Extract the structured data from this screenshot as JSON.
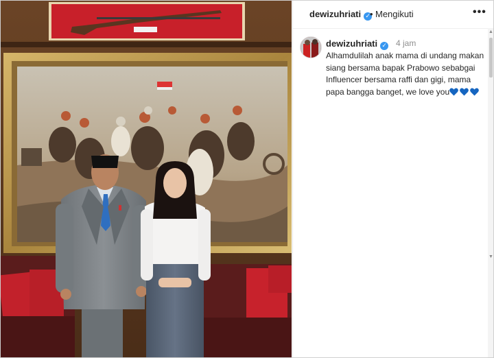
{
  "post": {
    "username": "dewizuhriati",
    "separator": "•",
    "follow_status": "Mengikuti",
    "more_icon": "more-options-icon"
  },
  "caption": {
    "username": "dewizuhriati",
    "time": "4 jam",
    "text": "Alhamdulilah anak mama di undang makan siang bersama bapak Prabowo sebabgai Influencer bersama raffi dan gigi, mama papa bangga banget, we love you",
    "emoji": [
      "blue-heart",
      "blue-heart",
      "blue-heart"
    ]
  },
  "colors": {
    "verified": "#3897f0",
    "heart": "#1565c0",
    "text": "#262626",
    "muted": "#8e8e8e"
  }
}
